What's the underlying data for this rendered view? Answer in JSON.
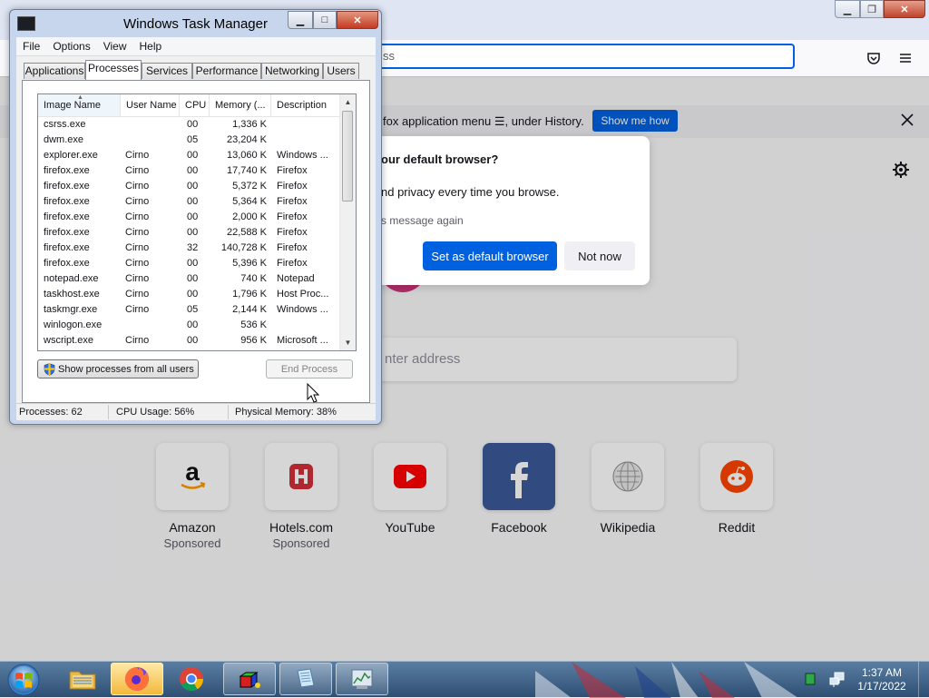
{
  "firefox": {
    "url_text": "ss",
    "notification": {
      "text": "fox application menu ☰, under History.",
      "button": "Show me how"
    },
    "dialog": {
      "title": "our default browser?",
      "body": "nd privacy every time you browse.",
      "checkbox": "s message again",
      "primary": "Set as default browser",
      "secondary": "Not now"
    },
    "search_placeholder": "nter address",
    "shortcuts": [
      {
        "name": "Amazon",
        "sponsored": "Sponsored"
      },
      {
        "name": "Hotels.com",
        "sponsored": "Sponsored"
      },
      {
        "name": "YouTube",
        "sponsored": ""
      },
      {
        "name": "Facebook",
        "sponsored": ""
      },
      {
        "name": "Wikipedia",
        "sponsored": ""
      },
      {
        "name": "Reddit",
        "sponsored": ""
      }
    ]
  },
  "taskmgr": {
    "title": "Windows Task Manager",
    "menu": [
      "File",
      "Options",
      "View",
      "Help"
    ],
    "tabs": [
      "Applications",
      "Processes",
      "Services",
      "Performance",
      "Networking",
      "Users"
    ],
    "active_tab": "Processes",
    "columns": [
      "Image Name",
      "User Name",
      "CPU",
      "Memory (...",
      "Description"
    ],
    "processes": [
      {
        "name": "csrss.exe",
        "user": "",
        "cpu": "00",
        "mem": "1,336 K",
        "desc": ""
      },
      {
        "name": "dwm.exe",
        "user": "",
        "cpu": "05",
        "mem": "23,204 K",
        "desc": ""
      },
      {
        "name": "explorer.exe",
        "user": "Cirno",
        "cpu": "00",
        "mem": "13,060 K",
        "desc": "Windows ..."
      },
      {
        "name": "firefox.exe",
        "user": "Cirno",
        "cpu": "00",
        "mem": "17,740 K",
        "desc": "Firefox"
      },
      {
        "name": "firefox.exe",
        "user": "Cirno",
        "cpu": "00",
        "mem": "5,372 K",
        "desc": "Firefox"
      },
      {
        "name": "firefox.exe",
        "user": "Cirno",
        "cpu": "00",
        "mem": "5,364 K",
        "desc": "Firefox"
      },
      {
        "name": "firefox.exe",
        "user": "Cirno",
        "cpu": "00",
        "mem": "2,000 K",
        "desc": "Firefox"
      },
      {
        "name": "firefox.exe",
        "user": "Cirno",
        "cpu": "00",
        "mem": "22,588 K",
        "desc": "Firefox"
      },
      {
        "name": "firefox.exe",
        "user": "Cirno",
        "cpu": "32",
        "mem": "140,728 K",
        "desc": "Firefox"
      },
      {
        "name": "firefox.exe",
        "user": "Cirno",
        "cpu": "00",
        "mem": "5,396 K",
        "desc": "Firefox"
      },
      {
        "name": "notepad.exe",
        "user": "Cirno",
        "cpu": "00",
        "mem": "740 K",
        "desc": "Notepad"
      },
      {
        "name": "taskhost.exe",
        "user": "Cirno",
        "cpu": "00",
        "mem": "1,796 K",
        "desc": "Host Proc..."
      },
      {
        "name": "taskmgr.exe",
        "user": "Cirno",
        "cpu": "05",
        "mem": "2,144 K",
        "desc": "Windows ..."
      },
      {
        "name": "winlogon.exe",
        "user": "",
        "cpu": "00",
        "mem": "536 K",
        "desc": ""
      },
      {
        "name": "wscript.exe",
        "user": "Cirno",
        "cpu": "00",
        "mem": "956 K",
        "desc": "Microsoft ..."
      }
    ],
    "show_all_button": "Show processes from all users",
    "end_process_button": "End Process",
    "status": {
      "processes": "Processes: 62",
      "cpu": "CPU Usage: 56%",
      "memory": "Physical Memory: 38%"
    }
  },
  "taskbar": {
    "time": "1:37 AM",
    "date": "1/17/2022",
    "items": [
      "explorer-folder",
      "firefox",
      "chrome",
      "app-cube",
      "notepad",
      "task-manager"
    ]
  },
  "colors": {
    "firefox_blue": "#0061e0",
    "taskbar_top": "#5a7ea3",
    "taskbar_bottom": "#2e4f73"
  }
}
